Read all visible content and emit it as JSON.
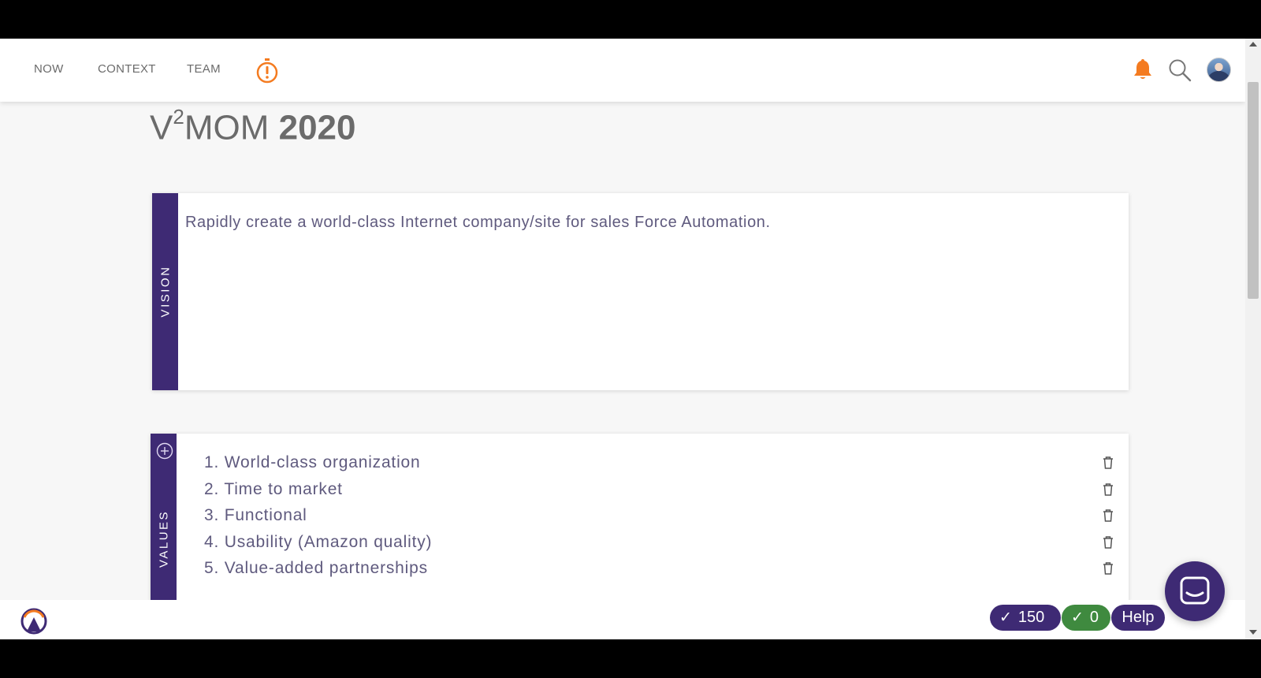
{
  "nav": {
    "items": [
      {
        "label": "NOW"
      },
      {
        "label": "CONTEXT"
      },
      {
        "label": "TEAM"
      }
    ]
  },
  "header_icons": {
    "timer": "stopwatch-alert-icon",
    "notifications": "bell-icon",
    "search": "search-icon",
    "avatar": "user-avatar"
  },
  "page": {
    "title_prefix": "V",
    "title_sup": "2",
    "title_suffix": "MOM ",
    "title_year": "2020"
  },
  "vision": {
    "label": "VISION",
    "text": "Rapidly create a world-class Internet company/site for sales Force Automation."
  },
  "values": {
    "label": "VALUES",
    "items": [
      {
        "text": "1. World-class organization"
      },
      {
        "text": "2. Time to market"
      },
      {
        "text": "3. Functional"
      },
      {
        "text": "4. Usability (Amazon quality)"
      },
      {
        "text": "5. Value-added partnerships"
      }
    ]
  },
  "footer": {
    "points": "150",
    "completed": "0",
    "help_label": "Help"
  },
  "colors": {
    "accent_purple": "#3e2a74",
    "success_green": "#3f8a3f",
    "orange": "#f47b20"
  }
}
